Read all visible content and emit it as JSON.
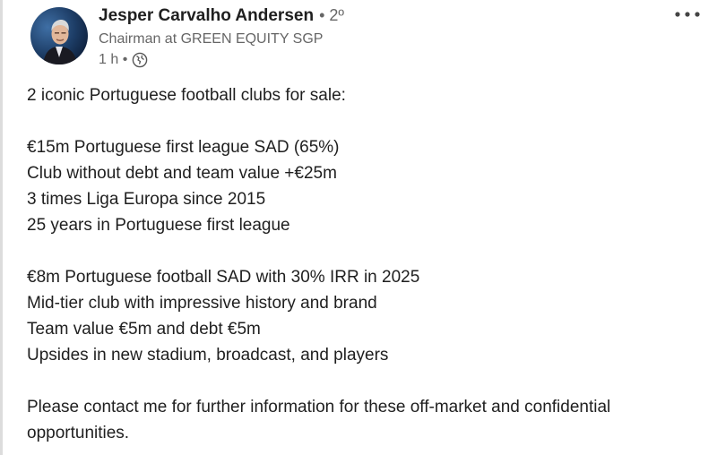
{
  "post": {
    "author": {
      "name": "Jesper Carvalho Andersen",
      "connection_degree": "• 2º",
      "headline": "Chairman at GREEN EQUITY SGP",
      "time": "1 h •"
    },
    "icons": {
      "avatar": "avatar-photo",
      "visibility": "globe-icon",
      "menu": "more-options-icon"
    },
    "body_lines": [
      "2 iconic Portuguese football clubs for sale:",
      "",
      "€15m Portuguese first league SAD (65%)",
      "Club without debt and team value +€25m",
      "3 times Liga Europa since 2015",
      "25 years in Portuguese first league",
      "",
      "€8m Portuguese football SAD with 30% IRR in 2025",
      "Mid-tier club with impressive history and brand",
      "Team value €5m and debt €5m",
      "Upsides in new stadium, broadcast, and players",
      "",
      "Please contact me for further information for these off-market and confidential",
      "opportunities."
    ]
  }
}
